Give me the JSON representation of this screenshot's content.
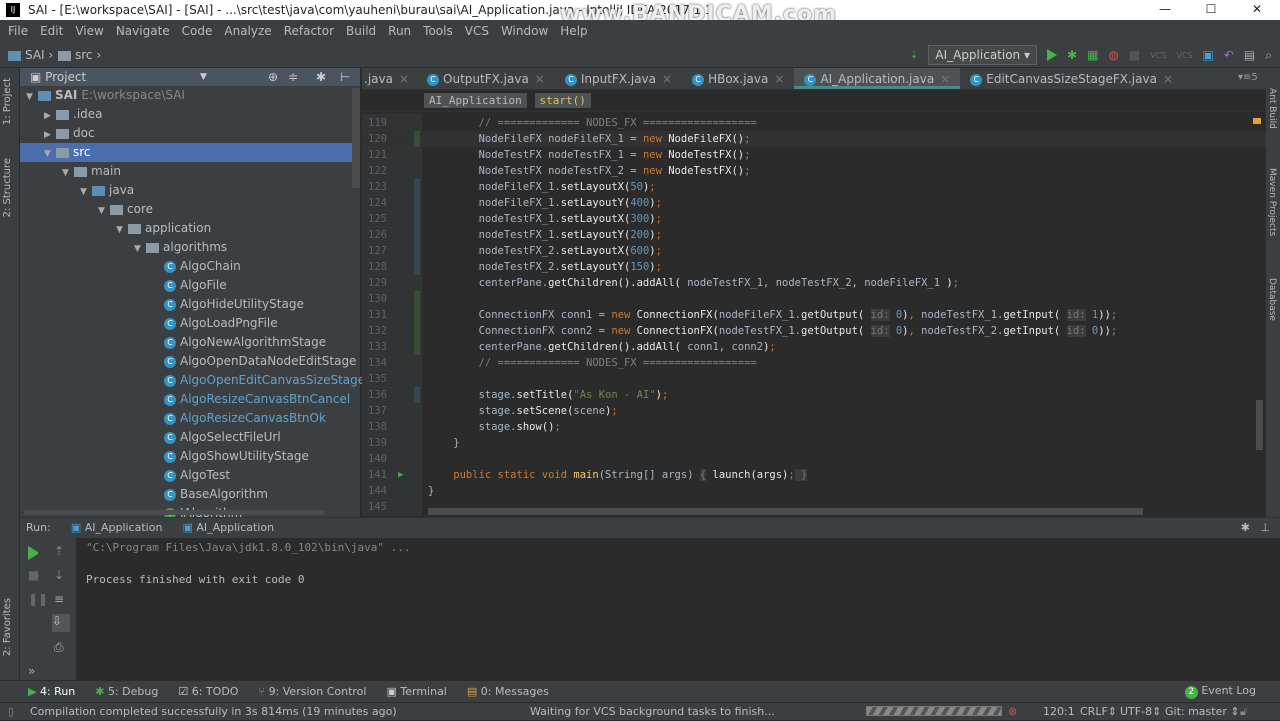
{
  "window": {
    "title": "SAI - [E:\\workspace\\SAI] - [SAI] - ...\\src\\test\\java\\com\\yauheni\\burau\\sai\\AI_Application.java - IntelliJ IDEA 2017.1.1",
    "watermark": "www.BANDICAM.com",
    "controls": [
      "—",
      "☐",
      "✕"
    ]
  },
  "menu": [
    "File",
    "Edit",
    "View",
    "Navigate",
    "Code",
    "Analyze",
    "Refactor",
    "Build",
    "Run",
    "Tools",
    "VCS",
    "Window",
    "Help"
  ],
  "nav": {
    "crumbs": [
      "SAI",
      "src"
    ]
  },
  "toolbar": {
    "run_config": "AI_Application ▾"
  },
  "left_stripe": [
    "1: Project",
    "2: Structure",
    "2: Favorites"
  ],
  "right_stripe": [
    "Ant Build",
    "Maven Projects",
    "Database"
  ],
  "project": {
    "title": "Project",
    "tree": [
      {
        "label": "SAI",
        "extra": "E:\\workspace\\SAI",
        "level": 0,
        "arrow": "▼",
        "icon": "module"
      },
      {
        "label": ".idea",
        "level": 1,
        "arrow": "▶",
        "icon": "folder"
      },
      {
        "label": "doc",
        "level": 1,
        "arrow": "▶",
        "icon": "folder"
      },
      {
        "label": "src",
        "level": 1,
        "arrow": "▼",
        "icon": "folder",
        "selected": true
      },
      {
        "label": "main",
        "level": 2,
        "arrow": "▼",
        "icon": "folder"
      },
      {
        "label": "java",
        "level": 3,
        "arrow": "▼",
        "icon": "folder-blue"
      },
      {
        "label": "core",
        "level": 4,
        "arrow": "▼",
        "icon": "package"
      },
      {
        "label": "application",
        "level": 5,
        "arrow": "▼",
        "icon": "package"
      },
      {
        "label": "algorithms",
        "level": 6,
        "arrow": "▼",
        "icon": "package"
      },
      {
        "label": "AlgoChain",
        "level": 7,
        "icon": "class"
      },
      {
        "label": "AlgoFile",
        "level": 7,
        "icon": "class"
      },
      {
        "label": "AlgoHideUtilityStage",
        "level": 7,
        "icon": "class"
      },
      {
        "label": "AlgoLoadPngFile",
        "level": 7,
        "icon": "class"
      },
      {
        "label": "AlgoNewAlgorithmStage",
        "level": 7,
        "icon": "class"
      },
      {
        "label": "AlgoOpenDataNodeEditStage",
        "level": 7,
        "icon": "class"
      },
      {
        "label": "AlgoOpenEditCanvasSizeStage",
        "level": 7,
        "icon": "class",
        "modified": true
      },
      {
        "label": "AlgoResizeCanvasBtnCancel",
        "level": 7,
        "icon": "class",
        "modified": true
      },
      {
        "label": "AlgoResizeCanvasBtnOk",
        "level": 7,
        "icon": "class",
        "modified": true
      },
      {
        "label": "AlgoSelectFileUrl",
        "level": 7,
        "icon": "class"
      },
      {
        "label": "AlgoShowUtilityStage",
        "level": 7,
        "icon": "class"
      },
      {
        "label": "AlgoTest",
        "level": 7,
        "icon": "class"
      },
      {
        "label": "BaseAlgorithm",
        "level": 7,
        "icon": "class"
      },
      {
        "label": "IAlgorithm",
        "level": 7,
        "icon": "interface"
      }
    ]
  },
  "tabs": [
    {
      "label": ".java"
    },
    {
      "label": "OutputFX.java"
    },
    {
      "label": "InputFX.java"
    },
    {
      "label": "HBox.java"
    },
    {
      "label": "AI_Application.java",
      "active": true
    },
    {
      "label": "EditCanvasSizeStageFX.java"
    }
  ],
  "tabs_overflow": "▾≡5",
  "editor_breadcrumb": [
    "AI_Application",
    "start()"
  ],
  "code": [
    {
      "n": "119",
      "segs": [
        [
          "cm",
          "        // ============= NODES_FX =================="
        ]
      ]
    },
    {
      "n": "120",
      "cur": true,
      "segs": [
        [
          "",
          "        NodeFileFX nodeFileFX_1 = "
        ],
        [
          "kw",
          "new "
        ],
        [
          "b",
          "NodeFileFX()"
        ],
        [
          "kw",
          ";"
        ]
      ]
    },
    {
      "n": "121",
      "segs": [
        [
          "",
          "        NodeTestFX nodeTestFX_1 = "
        ],
        [
          "kw",
          "new "
        ],
        [
          "b",
          "NodeTestFX()"
        ],
        [
          "kw",
          ";"
        ]
      ]
    },
    {
      "n": "122",
      "segs": [
        [
          "",
          "        NodeTestFX nodeTestFX_2 = "
        ],
        [
          "kw",
          "new "
        ],
        [
          "b",
          "NodeTestFX()"
        ],
        [
          "kw",
          ";"
        ]
      ]
    },
    {
      "n": "123",
      "segs": [
        [
          "",
          "        nodeFileFX_1."
        ],
        [
          "b",
          "setLayoutX("
        ],
        [
          "num",
          "50"
        ],
        [
          "b",
          ")"
        ],
        [
          "kw",
          ";"
        ]
      ]
    },
    {
      "n": "124",
      "segs": [
        [
          "",
          "        nodeFileFX_1."
        ],
        [
          "b",
          "setLayoutY("
        ],
        [
          "num",
          "400"
        ],
        [
          "b",
          ")"
        ],
        [
          "kw",
          ";"
        ]
      ]
    },
    {
      "n": "125",
      "segs": [
        [
          "",
          "        nodeTestFX_1."
        ],
        [
          "b",
          "setLayoutX("
        ],
        [
          "num",
          "300"
        ],
        [
          "b",
          ")"
        ],
        [
          "kw",
          ";"
        ]
      ]
    },
    {
      "n": "126",
      "segs": [
        [
          "",
          "        nodeTestFX_1."
        ],
        [
          "b",
          "setLayoutY("
        ],
        [
          "num",
          "200"
        ],
        [
          "b",
          ")"
        ],
        [
          "kw",
          ";"
        ]
      ]
    },
    {
      "n": "127",
      "segs": [
        [
          "",
          "        nodeTestFX_2."
        ],
        [
          "b",
          "setLayoutX("
        ],
        [
          "num",
          "600"
        ],
        [
          "b",
          ")"
        ],
        [
          "kw",
          ";"
        ]
      ]
    },
    {
      "n": "128",
      "segs": [
        [
          "",
          "        nodeTestFX_2."
        ],
        [
          "b",
          "setLayoutY("
        ],
        [
          "num",
          "150"
        ],
        [
          "b",
          ")"
        ],
        [
          "kw",
          ";"
        ]
      ]
    },
    {
      "n": "129",
      "segs": [
        [
          "",
          "        centerPane."
        ],
        [
          "b",
          "getChildren().addAll("
        ],
        [
          "",
          " nodeTestFX_1, nodeTestFX_2, nodeFileFX_1 "
        ],
        [
          "b",
          ")"
        ],
        [
          "kw",
          ";"
        ]
      ]
    },
    {
      "n": "130",
      "segs": []
    },
    {
      "n": "131",
      "segs": [
        [
          "",
          "        ConnectionFX conn1 = "
        ],
        [
          "kw",
          "new "
        ],
        [
          "b",
          "ConnectionFX("
        ],
        [
          "",
          "nodeFileFX_1."
        ],
        [
          "b",
          "getOutput( "
        ],
        [
          "hint",
          "id:"
        ],
        [
          "num",
          " 0"
        ],
        [
          "b",
          ")"
        ],
        [
          "kw",
          ", "
        ],
        [
          "",
          "nodeTestFX_1."
        ],
        [
          "b",
          "getInput( "
        ],
        [
          "hint",
          "id:"
        ],
        [
          "num",
          " 1"
        ],
        [
          "b",
          "))"
        ],
        [
          "kw",
          ";"
        ]
      ]
    },
    {
      "n": "132",
      "segs": [
        [
          "",
          "        ConnectionFX conn2 = "
        ],
        [
          "kw",
          "new "
        ],
        [
          "b",
          "ConnectionFX("
        ],
        [
          "",
          "nodeTestFX_1."
        ],
        [
          "b",
          "getOutput( "
        ],
        [
          "hint",
          "id:"
        ],
        [
          "num",
          " 0"
        ],
        [
          "b",
          ")"
        ],
        [
          "kw",
          ", "
        ],
        [
          "",
          "nodeTestFX_2."
        ],
        [
          "b",
          "getInput( "
        ],
        [
          "hint",
          "id:"
        ],
        [
          "num",
          " 0"
        ],
        [
          "b",
          "))"
        ],
        [
          "kw",
          ";"
        ]
      ]
    },
    {
      "n": "133",
      "segs": [
        [
          "",
          "        centerPane."
        ],
        [
          "b",
          "getChildren().addAll("
        ],
        [
          "",
          " conn1, conn2"
        ],
        [
          "b",
          ")"
        ],
        [
          "kw",
          ";"
        ]
      ]
    },
    {
      "n": "134",
      "segs": [
        [
          "cm",
          "        // ============= NODES_FX =================="
        ]
      ]
    },
    {
      "n": "135",
      "segs": []
    },
    {
      "n": "136",
      "segs": [
        [
          "",
          "        stage."
        ],
        [
          "b",
          "setTitle("
        ],
        [
          "str",
          "\"As Kon - AI\""
        ],
        [
          "b",
          ")"
        ],
        [
          "kw",
          ";"
        ]
      ]
    },
    {
      "n": "137",
      "segs": [
        [
          "",
          "        stage."
        ],
        [
          "b",
          "setScene("
        ],
        [
          "",
          "scene"
        ],
        [
          "b",
          ")"
        ],
        [
          "kw",
          ";"
        ]
      ]
    },
    {
      "n": "138",
      "segs": [
        [
          "",
          "        stage."
        ],
        [
          "b",
          "show()"
        ],
        [
          "kw",
          ";"
        ]
      ]
    },
    {
      "n": "139",
      "segs": [
        [
          "",
          "    }"
        ]
      ]
    },
    {
      "n": "140",
      "segs": []
    },
    {
      "n": "141",
      "segs": [
        [
          "kw",
          "    public static void "
        ],
        [
          "fn",
          "main"
        ],
        [
          "",
          "(String[] args) "
        ],
        [
          "hint",
          "{"
        ],
        [
          "b",
          " launch(args)"
        ],
        [
          "kw",
          ";"
        ],
        [
          "hint",
          " }"
        ]
      ]
    },
    {
      "n": "144",
      "segs": [
        [
          "",
          "}"
        ]
      ]
    },
    {
      "n": "145",
      "segs": []
    }
  ],
  "run": {
    "label": "Run:",
    "tabs": [
      "AI_Application",
      "AI_Application"
    ],
    "console": [
      "\"C:\\Program Files\\Java\\jdk1.8.0_102\\bin\\java\" ...",
      "",
      "Process finished with exit code 0"
    ]
  },
  "bottom_tools": [
    "4: Run",
    "5: Debug",
    "6: TODO",
    "9: Version Control",
    "Terminal",
    "0: Messages"
  ],
  "event_log": {
    "label": "Event Log",
    "count": "2"
  },
  "status": {
    "message": "Compilation completed successfully in 3s 814ms (19 minutes ago)",
    "background": "Waiting for VCS background tasks to finish...",
    "position": "120:1",
    "line_sep": "CRLF⇕",
    "encoding": "UTF-8⇕",
    "vcs": "Git: master ⇕"
  }
}
